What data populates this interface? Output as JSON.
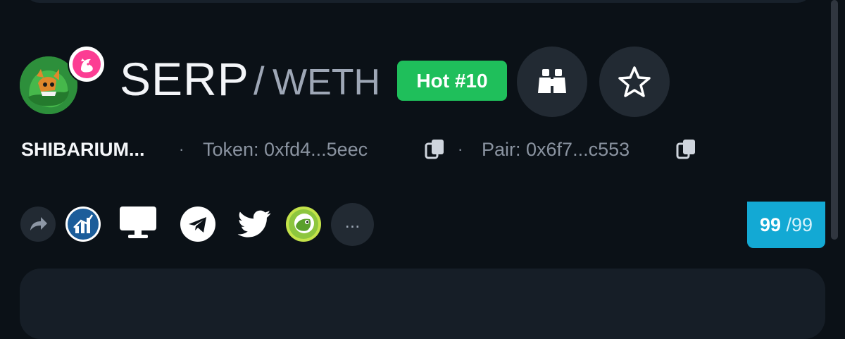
{
  "header": {
    "symbol": "SERP",
    "separator": "/",
    "quote": "WETH",
    "hot_badge": "Hot #10"
  },
  "meta": {
    "chain": "SHIBARIUM...",
    "dot": "·",
    "token_label": "Token: 0xfd4...5eec",
    "pair_label": "Pair: 0x6f7...c553"
  },
  "links": {
    "more": "...",
    "icons": [
      "share-icon",
      "chart-icon",
      "website-icon",
      "telegram-icon",
      "twitter-icon",
      "coingecko-icon"
    ]
  },
  "counter": {
    "current": "99",
    "total": "/99"
  },
  "colors": {
    "hot": "#1fbf5b",
    "counter": "#13a9d4",
    "background": "#0b1117",
    "button": "#222a33"
  }
}
